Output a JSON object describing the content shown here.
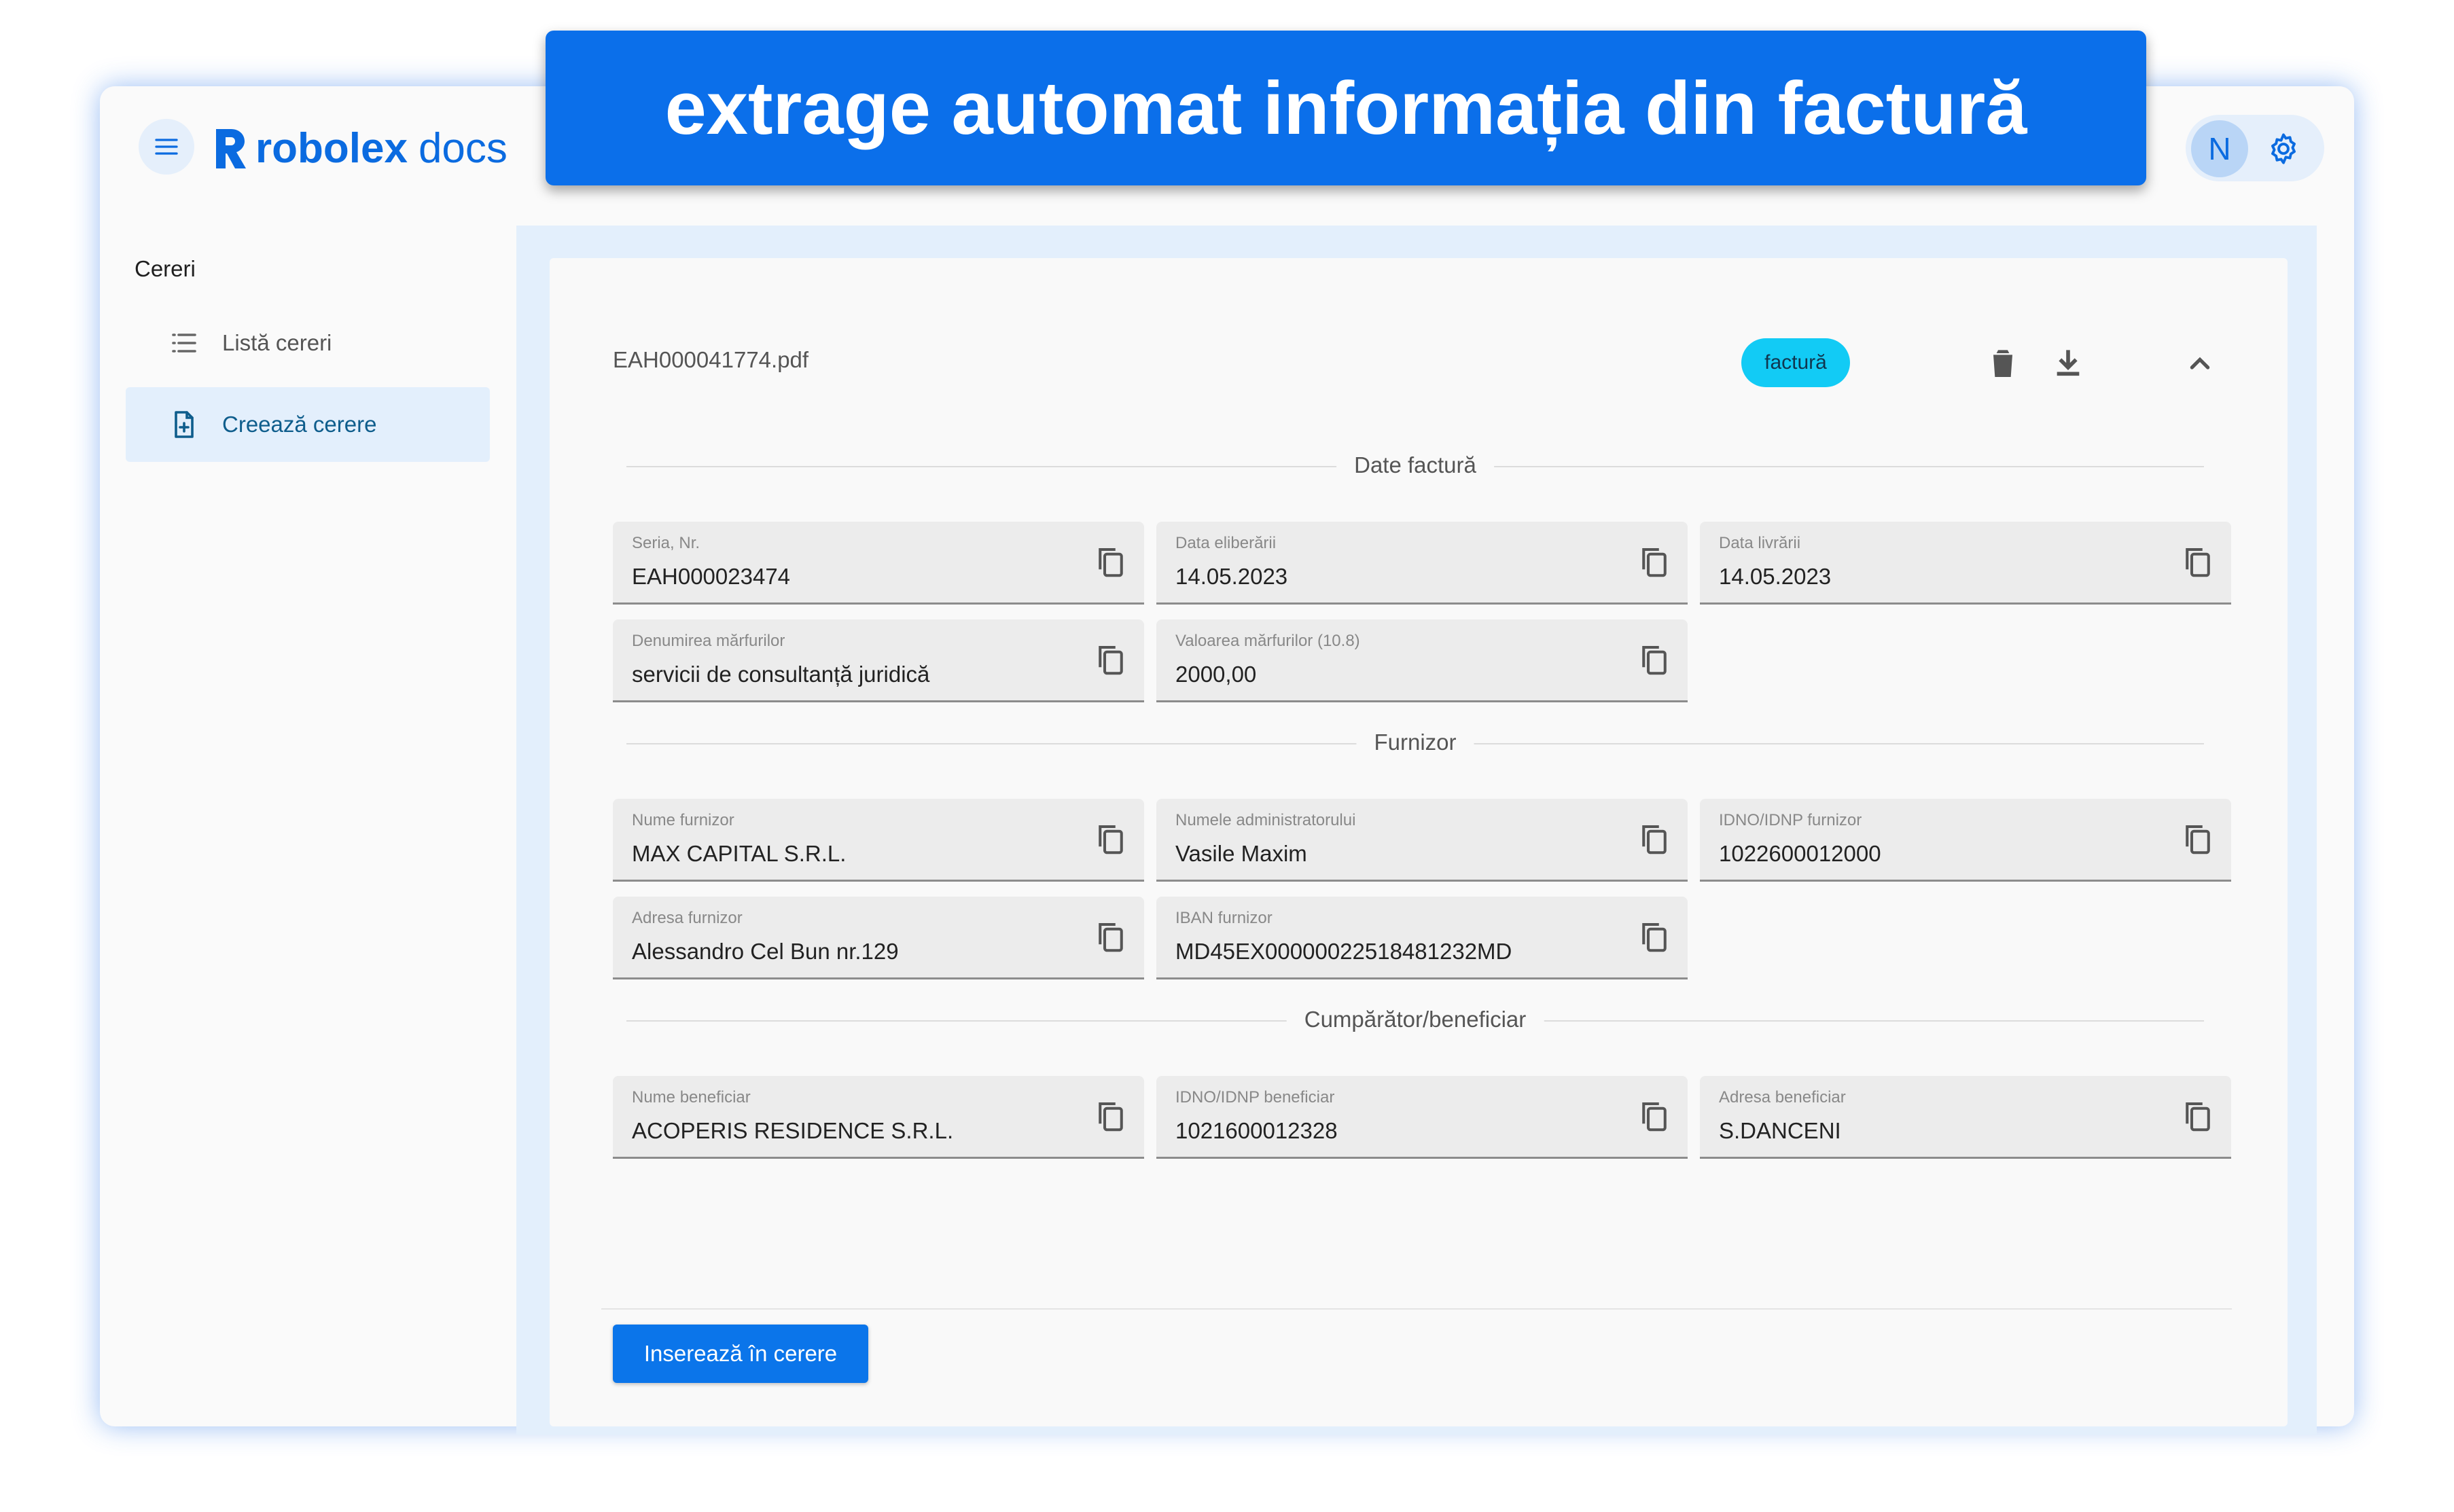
{
  "banner": {
    "text": "extrage automat informația din factură"
  },
  "header": {
    "brand_bold": "robolex",
    "brand_light": "docs",
    "user_initial": "N"
  },
  "sidebar": {
    "heading": "Cereri",
    "items": [
      {
        "label": "Listă cereri",
        "icon": "list-icon",
        "active": false
      },
      {
        "label": "Creează cerere",
        "icon": "file-add-icon",
        "active": true
      }
    ]
  },
  "document": {
    "file_name": "EAH000041774.pdf",
    "type_chip": "factură"
  },
  "sections": {
    "invoice": {
      "title": "Date factură",
      "fields": [
        {
          "label": "Seria, Nr.",
          "value": "EAH000023474"
        },
        {
          "label": "Data eliberării",
          "value": "14.05.2023"
        },
        {
          "label": "Data livrării",
          "value": "14.05.2023"
        },
        {
          "label": "Denumirea mărfurilor",
          "value": "servicii de consultanță juridică"
        },
        {
          "label": "Valoarea mărfurilor (10.8)",
          "value": "2000,00"
        }
      ]
    },
    "supplier": {
      "title": "Furnizor",
      "fields": [
        {
          "label": "Nume furnizor",
          "value": "MAX CAPITAL S.R.L."
        },
        {
          "label": "Numele administratorului",
          "value": "Vasile Maxim"
        },
        {
          "label": "IDNO/IDNP furnizor",
          "value": "1022600012000"
        },
        {
          "label": "Adresa furnizor",
          "value": "Alessandro Cel Bun nr.129"
        },
        {
          "label": "IBAN furnizor",
          "value": "MD45EX0000002251848123​2MD"
        }
      ]
    },
    "buyer": {
      "title": "Cumpărător/beneficiar",
      "fields": [
        {
          "label": "Nume beneficiar",
          "value": "ACOPERIS RESIDENCE S.R.L."
        },
        {
          "label": "IDNO/IDNP beneficiar",
          "value": "1021600012328"
        },
        {
          "label": "Adresa beneficiar",
          "value": "S.DANCENI"
        }
      ]
    }
  },
  "actions": {
    "insert_label": "Inserează în cerere"
  },
  "colors": {
    "primary": "#0b6fea",
    "chip": "#12cbf5",
    "selected_bg": "#e3effc"
  }
}
